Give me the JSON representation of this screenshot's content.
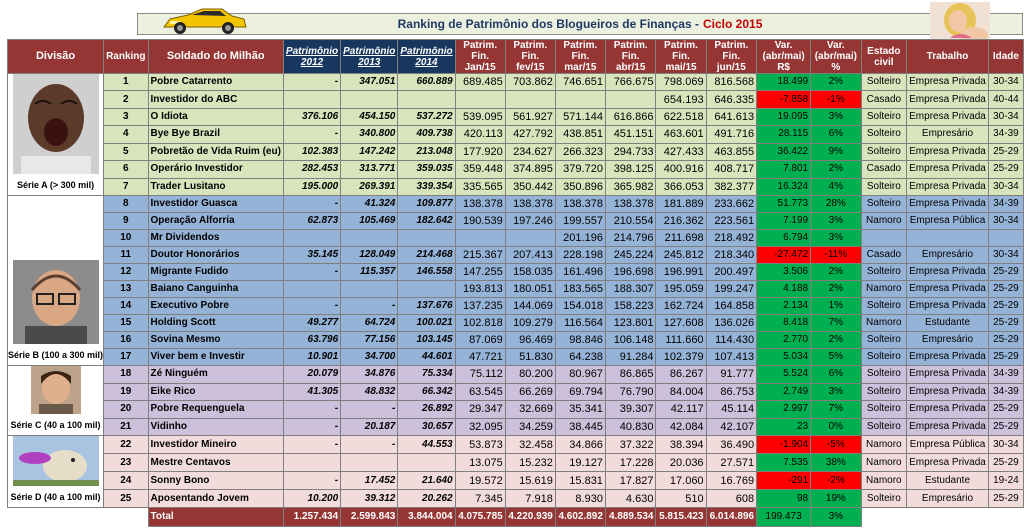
{
  "title": {
    "text": "Ranking de Patrimônio dos Blogueiros de Finanças -",
    "cycle": "Ciclo 2015"
  },
  "headers": [
    "Divisão",
    "Ranking",
    "Soldado do Milhão",
    "Patrimônio 2012",
    "Patrimônio 2013",
    "Patrimônio 2014",
    "Patrim. Fin. Jan/15",
    "Patrim. Fin. fev/15",
    "Patrim. Fin. mar/15",
    "Patrim. Fin. abr/15",
    "Patrim. Fin. mai/15",
    "Patrim. Fin. jun/15",
    "Var. (abr/mai) R$",
    "Var. (abr/mai) %",
    "Estado civil",
    "Trabalho",
    "Idade"
  ],
  "divisions": [
    {
      "label": "Série A (> 300 mil)",
      "class": "sa",
      "start": 0,
      "span": 7,
      "icon": "yawning-man-photo"
    },
    {
      "label": "Série B (100 a 300 mil)",
      "class": "sb",
      "start": 7,
      "span": 10,
      "icon": "bald-man-glasses-photo"
    },
    {
      "label": "Série C (40 a 100 mil)",
      "class": "sc",
      "start": 17,
      "span": 4,
      "icon": "young-man-photo"
    },
    {
      "label": "Série D (40 a 100 mil)",
      "class": "sd",
      "start": 21,
      "span": 4,
      "icon": "dog-frisbee-photo"
    }
  ],
  "rows": [
    {
      "rank": "1",
      "name": "Pobre Catarrento",
      "p2012": "-",
      "p2013": "347.051",
      "p2014": "660.889",
      "jan": "689.485",
      "fev": "703.862",
      "mar": "746.651",
      "abr": "766.675",
      "mai": "798.069",
      "jun": "816.568",
      "var": "18.499",
      "pct": "2%",
      "civil": "Solteiro",
      "job": "Empresa Privada",
      "age": "30-34"
    },
    {
      "rank": "2",
      "name": "Investidor do ABC",
      "p2012": "",
      "p2013": "",
      "p2014": "",
      "jan": "",
      "fev": "",
      "mar": "",
      "abr": "",
      "mai": "654.193",
      "jun": "646.335",
      "var": "-7.858",
      "pct": "-1%",
      "civil": "Casado",
      "job": "Empresa Privada",
      "age": "40-44",
      "neg": true
    },
    {
      "rank": "3",
      "name": "O Idiota",
      "p2012": "376.106",
      "p2013": "454.150",
      "p2014": "537.272",
      "jan": "539.095",
      "fev": "561.927",
      "mar": "571.144",
      "abr": "616.866",
      "mai": "622.518",
      "jun": "641.613",
      "var": "19.095",
      "pct": "3%",
      "civil": "Solteiro",
      "job": "Empresa Privada",
      "age": "30-34"
    },
    {
      "rank": "4",
      "name": "Bye Bye Brazil",
      "p2012": "-",
      "p2013": "340.800",
      "p2014": "409.738",
      "jan": "420.113",
      "fev": "427.792",
      "mar": "438.851",
      "abr": "451.151",
      "mai": "463.601",
      "jun": "491.716",
      "var": "28.115",
      "pct": "6%",
      "civil": "Solteiro",
      "job": "Empresário",
      "age": "34-39"
    },
    {
      "rank": "5",
      "name": "Pobretão de Vida Ruim (eu)",
      "p2012": "102.383",
      "p2013": "147.242",
      "p2014": "213.048",
      "jan": "177.920",
      "fev": "234.627",
      "mar": "266.323",
      "abr": "294.733",
      "mai": "427.433",
      "jun": "463.855",
      "var": "36.422",
      "pct": "9%",
      "civil": "Solteiro",
      "job": "Empresa Privada",
      "age": "25-29"
    },
    {
      "rank": "6",
      "name": "Operário Investidor",
      "p2012": "282.453",
      "p2013": "313.771",
      "p2014": "359.035",
      "jan": "359.448",
      "fev": "374.895",
      "mar": "379.720",
      "abr": "398.125",
      "mai": "400.916",
      "jun": "408.717",
      "var": "7.801",
      "pct": "2%",
      "civil": "Casado",
      "job": "Empresa Privada",
      "age": "25-29"
    },
    {
      "rank": "7",
      "name": "Trader Lusitano",
      "p2012": "195.000",
      "p2013": "269.391",
      "p2014": "339.354",
      "jan": "335.565",
      "fev": "350.442",
      "mar": "350.896",
      "abr": "365.982",
      "mai": "366.053",
      "jun": "382.377",
      "var": "16.324",
      "pct": "4%",
      "civil": "Solteiro",
      "job": "Empresa Privada",
      "age": "30-34"
    },
    {
      "rank": "8",
      "name": "Investidor Guasca",
      "p2012": "-",
      "p2013": "41.324",
      "p2014": "109.877",
      "jan": "138.378",
      "fev": "138.378",
      "mar": "138.378",
      "abr": "138.378",
      "mai": "181.889",
      "jun": "233.662",
      "var": "51.773",
      "pct": "28%",
      "civil": "Solteiro",
      "job": "Empresa Privada",
      "age": "34-39"
    },
    {
      "rank": "9",
      "name": "Operação Alforria",
      "p2012": "62.873",
      "p2013": "105.469",
      "p2014": "182.642",
      "jan": "190.539",
      "fev": "197.246",
      "mar": "199.557",
      "abr": "210.554",
      "mai": "216.362",
      "jun": "223.561",
      "var": "7.199",
      "pct": "3%",
      "civil": "Namoro",
      "job": "Empresa Pública",
      "age": "30-34"
    },
    {
      "rank": "10",
      "name": "Mr Dividendos",
      "p2012": "",
      "p2013": "",
      "p2014": "",
      "jan": "",
      "fev": "",
      "mar": "201.196",
      "abr": "214.796",
      "mai": "211.698",
      "jun": "218.492",
      "var": "6.794",
      "pct": "3%",
      "civil": "",
      "job": "",
      "age": ""
    },
    {
      "rank": "11",
      "name": "Doutor Honorários",
      "p2012": "35.145",
      "p2013": "128.049",
      "p2014": "214.468",
      "jan": "215.367",
      "fev": "207.413",
      "mar": "228.198",
      "abr": "245.224",
      "mai": "245.812",
      "jun": "218.340",
      "var": "-27.472",
      "pct": "-11%",
      "civil": "Casado",
      "job": "Empresário",
      "age": "30-34",
      "neg": true
    },
    {
      "rank": "12",
      "name": "Migrante Fudido",
      "p2012": "-",
      "p2013": "115.357",
      "p2014": "146.558",
      "jan": "147.255",
      "fev": "158.035",
      "mar": "161.496",
      "abr": "196.698",
      "mai": "196.991",
      "jun": "200.497",
      "var": "3.506",
      "pct": "2%",
      "civil": "Solteiro",
      "job": "Empresa Privada",
      "age": "25-29"
    },
    {
      "rank": "13",
      "name": "Baiano Canguinha",
      "p2012": "",
      "p2013": "",
      "p2014": "",
      "jan": "193.813",
      "fev": "180.051",
      "mar": "183.565",
      "abr": "188.307",
      "mai": "195.059",
      "jun": "199.247",
      "var": "4.188",
      "pct": "2%",
      "civil": "Namoro",
      "job": "Empresa Privada",
      "age": "25-29"
    },
    {
      "rank": "14",
      "name": "Executivo Pobre",
      "p2012": "-",
      "p2013": "-",
      "p2014": "137.676",
      "jan": "137.235",
      "fev": "144.069",
      "mar": "154.018",
      "abr": "158.223",
      "mai": "162.724",
      "jun": "164.858",
      "var": "2.134",
      "pct": "1%",
      "civil": "Solteiro",
      "job": "Empresa Privada",
      "age": "25-29"
    },
    {
      "rank": "15",
      "name": "Holding Scott",
      "p2012": "49.277",
      "p2013": "64.724",
      "p2014": "100.021",
      "jan": "102.818",
      "fev": "109.279",
      "mar": "116.564",
      "abr": "123.801",
      "mai": "127.608",
      "jun": "136.026",
      "var": "8.418",
      "pct": "7%",
      "civil": "Namoro",
      "job": "Estudante",
      "age": "25-29"
    },
    {
      "rank": "16",
      "name": "Sovina Mesmo",
      "p2012": "63.796",
      "p2013": "77.156",
      "p2014": "103.145",
      "jan": "87.069",
      "fev": "96.469",
      "mar": "98.846",
      "abr": "106.148",
      "mai": "111.660",
      "jun": "114.430",
      "var": "2.770",
      "pct": "2%",
      "civil": "Solteiro",
      "job": "Empresário",
      "age": "25-29"
    },
    {
      "rank": "17",
      "name": "Viver bem e Investir",
      "p2012": "10.901",
      "p2013": "34.700",
      "p2014": "44.601",
      "jan": "47.721",
      "fev": "51.830",
      "mar": "64.238",
      "abr": "91.284",
      "mai": "102.379",
      "jun": "107.413",
      "var": "5.034",
      "pct": "5%",
      "civil": "Solteiro",
      "job": "Empresa Privada",
      "age": "25-29"
    },
    {
      "rank": "18",
      "name": "Zé Ninguém",
      "p2012": "20.079",
      "p2013": "34.876",
      "p2014": "75.334",
      "jan": "75.112",
      "fev": "80.200",
      "mar": "80.967",
      "abr": "86.865",
      "mai": "86.267",
      "jun": "91.777",
      "var": "5.524",
      "pct": "6%",
      "civil": "Solteiro",
      "job": "Empresa Privada",
      "age": "34-39"
    },
    {
      "rank": "19",
      "name": "Eike Rico",
      "p2012": "41.305",
      "p2013": "48.832",
      "p2014": "66.342",
      "jan": "63.545",
      "fev": "66.269",
      "mar": "69.794",
      "abr": "76.790",
      "mai": "84.004",
      "jun": "86.753",
      "var": "2.749",
      "pct": "3%",
      "civil": "Solteiro",
      "job": "Empresa Privada",
      "age": "34-39"
    },
    {
      "rank": "20",
      "name": "Pobre Requenguela",
      "p2012": "-",
      "p2013": "-",
      "p2014": "26.892",
      "jan": "29.347",
      "fev": "32.669",
      "mar": "35.341",
      "abr": "39.307",
      "mai": "42.117",
      "jun": "45.114",
      "var": "2.997",
      "pct": "7%",
      "civil": "Solteiro",
      "job": "Empresa Privada",
      "age": "25-29"
    },
    {
      "rank": "21",
      "name": "Vidinho",
      "p2012": "-",
      "p2013": "20.187",
      "p2014": "30.657",
      "jan": "32.095",
      "fev": "34.259",
      "mar": "38.445",
      "abr": "40.830",
      "mai": "42.084",
      "jun": "42.107",
      "var": "23",
      "pct": "0%",
      "civil": "Solteiro",
      "job": "Empresa Privada",
      "age": "25-29"
    },
    {
      "rank": "22",
      "name": "Investidor Mineiro",
      "p2012": "-",
      "p2013": "-",
      "p2014": "44.553",
      "jan": "53.873",
      "fev": "32.458",
      "mar": "34.866",
      "abr": "37.322",
      "mai": "38.394",
      "jun": "36.490",
      "var": "-1.904",
      "pct": "-5%",
      "civil": "Namoro",
      "job": "Empresa Pública",
      "age": "30-34",
      "neg": true
    },
    {
      "rank": "23",
      "name": "Mestre Centavos",
      "p2012": "",
      "p2013": "",
      "p2014": "",
      "jan": "13.075",
      "fev": "15.232",
      "mar": "19.127",
      "abr": "17.228",
      "mai": "20.036",
      "jun": "27.571",
      "var": "7.535",
      "pct": "38%",
      "civil": "Namoro",
      "job": "Empresa Privada",
      "age": "25-29"
    },
    {
      "rank": "24",
      "name": "Sonny Bono",
      "p2012": "-",
      "p2013": "17.452",
      "p2014": "21.640",
      "jan": "19.572",
      "fev": "15.619",
      "mar": "15.831",
      "abr": "17.827",
      "mai": "17.060",
      "jun": "16.769",
      "var": "-291",
      "pct": "-2%",
      "civil": "Namoro",
      "job": "Estudante",
      "age": "19-24",
      "neg": true
    },
    {
      "rank": "25",
      "name": "Aposentando Jovem",
      "p2012": "10.200",
      "p2013": "39.312",
      "p2014": "20.262",
      "jan": "7.345",
      "fev": "7.918",
      "mar": "8.930",
      "abr": "4.630",
      "mai": "510",
      "jun": "608",
      "var": "98",
      "pct": "19%",
      "civil": "Solteiro",
      "job": "Empresário",
      "age": "25-29"
    }
  ],
  "total": {
    "label": "Total",
    "p2012": "1.257.434",
    "p2013": "2.599.843",
    "p2014": "3.844.004",
    "jan": "4.075.785",
    "fev": "4.220.939",
    "mar": "4.602.892",
    "abr": "4.889.534",
    "mai": "5.815.423",
    "jun": "6.014.896",
    "var": "199.473",
    "pct": "3%"
  },
  "colors": {
    "header": "#963634",
    "navy": "#17375e",
    "serieA": "#d8e4bc",
    "serieB": "#95b3d7",
    "serieC": "#ccc0da",
    "serieD": "#f2dcdb",
    "green": "#00b050",
    "red": "#ff0000"
  }
}
